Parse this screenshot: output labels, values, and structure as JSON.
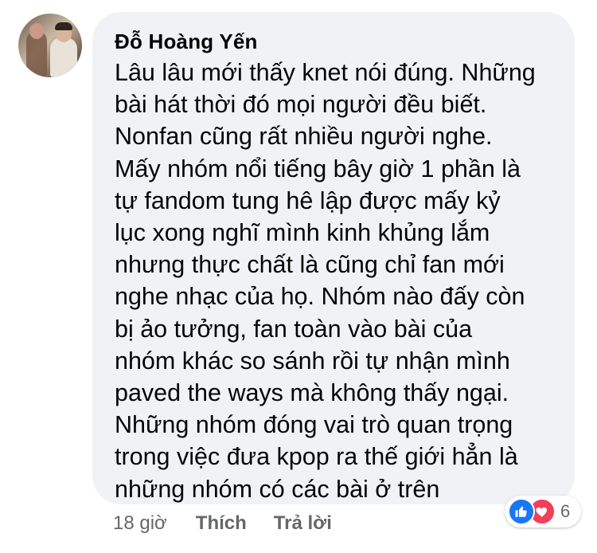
{
  "comment": {
    "author": "Đỗ Hoàng Yến",
    "text": "Lâu lâu mới thấy knet nói đúng. Những\nbài hát thời đó mọi người đều biết.\nNonfan cũng rất nhiều người nghe.\nMấy nhóm nổi tiếng bây giờ 1 phần là\ntự fandom tung hê lập được mấy kỷ\nlục xong nghĩ mình kinh khủng lắm\nnhưng thực chất là cũng chỉ fan mới\nnghe nhạc của họ. Nhóm nào đấy còn\nbị ảo tưởng, fan toàn vào bài của\nnhóm khác so sánh rồi tự nhận mình\npaved the ways mà không thấy ngại.\nNhững nhóm đóng vai trò quan trọng\ntrong việc đưa kpop ra thế giới hẳn là\nnhững nhóm có các bài ở trên"
  },
  "actions": {
    "time": "18 giờ",
    "like_label": "Thích",
    "reply_label": "Trả lời"
  },
  "reactions": {
    "count": "6",
    "icons": [
      "thumbs-up-icon",
      "heart-icon"
    ],
    "like_color": "#1877f2",
    "love_color": "#f33e58"
  },
  "colors": {
    "bubble_bg": "#f0f2f5",
    "text": "#050505",
    "meta": "#65676b"
  }
}
